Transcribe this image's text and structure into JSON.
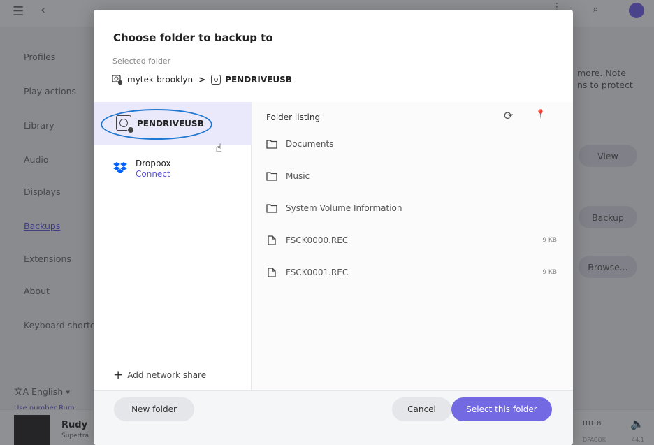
{
  "app": {
    "sidebar": [
      {
        "label": "Profiles"
      },
      {
        "label": "Play actions"
      },
      {
        "label": "Library"
      },
      {
        "label": "Audio"
      },
      {
        "label": "Displays"
      },
      {
        "label": "Backups",
        "active": true
      },
      {
        "label": "Extensions"
      },
      {
        "label": "About"
      },
      {
        "label": "Keyboard shortc"
      }
    ],
    "language": "English",
    "language_caret": "▾",
    "use_link": "Use number Rum",
    "content_text_1": "more. Note",
    "content_text_2": "ns to protect",
    "buttons": {
      "view": "View",
      "backup": "Backup",
      "browse": "Browse..."
    },
    "player": {
      "title": "Rudy",
      "artist": "Supertra",
      "codec": "IIII:8",
      "sub1": "DPACOK",
      "sub2": "44.1"
    }
  },
  "dialog": {
    "title": "Choose folder to backup to",
    "selected_label": "Selected folder",
    "breadcrumb": {
      "device": "mytek-brooklyn",
      "separator": ">",
      "folder": "PENDRIVEUSB"
    },
    "locations": [
      {
        "name": "PENDRIVEUSB",
        "selected": true
      },
      {
        "name": "Dropbox",
        "action": "Connect"
      }
    ],
    "add_network_share": "Add network share",
    "listing": {
      "header": "Folder listing",
      "items": [
        {
          "type": "folder",
          "name": "Documents",
          "size": ""
        },
        {
          "type": "folder",
          "name": "Music",
          "size": ""
        },
        {
          "type": "folder",
          "name": "System Volume Information",
          "size": ""
        },
        {
          "type": "file",
          "name": "FSCK0000.REC",
          "size": "9 KB"
        },
        {
          "type": "file",
          "name": "FSCK0001.REC",
          "size": "9 KB"
        }
      ]
    },
    "footer": {
      "new_folder": "New folder",
      "cancel": "Cancel",
      "select": "Select this folder"
    }
  },
  "colors": {
    "accent": "#7269e3",
    "selected_bg": "#eae9fb",
    "highlight_ring": "#1f78d1",
    "dropbox": "#0061fe"
  }
}
